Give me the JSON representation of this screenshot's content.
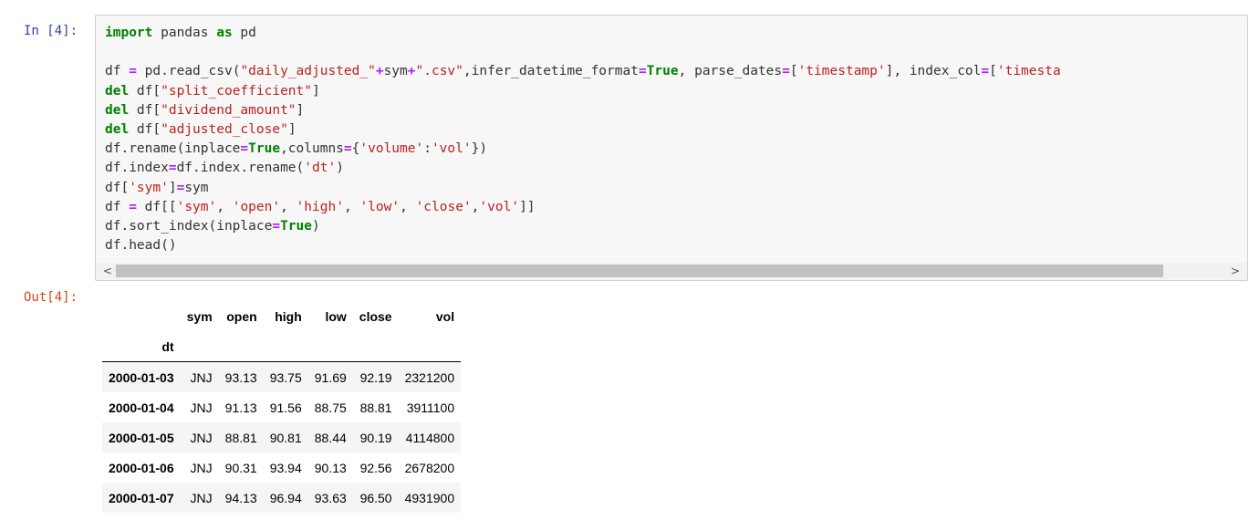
{
  "input_prompt": "In [4]:",
  "output_prompt": "Out[4]:",
  "code_lines": [
    [
      {
        "t": "import",
        "c": "kw"
      },
      {
        "t": " pandas ",
        "c": "nm"
      },
      {
        "t": "as",
        "c": "kw"
      },
      {
        "t": " pd",
        "c": "nm"
      }
    ],
    [],
    [
      {
        "t": "df ",
        "c": "nm"
      },
      {
        "t": "=",
        "c": "op"
      },
      {
        "t": " pd.read_csv(",
        "c": "nm"
      },
      {
        "t": "\"daily_adjusted_\"",
        "c": "str"
      },
      {
        "t": "+",
        "c": "op"
      },
      {
        "t": "sym",
        "c": "nm"
      },
      {
        "t": "+",
        "c": "op"
      },
      {
        "t": "\".csv\"",
        "c": "str"
      },
      {
        "t": ",infer_datetime_format",
        "c": "nm"
      },
      {
        "t": "=",
        "c": "op"
      },
      {
        "t": "True",
        "c": "kw"
      },
      {
        "t": ", parse_dates",
        "c": "nm"
      },
      {
        "t": "=",
        "c": "op"
      },
      {
        "t": "[",
        "c": "nm"
      },
      {
        "t": "'timestamp'",
        "c": "str"
      },
      {
        "t": "], index_col",
        "c": "nm"
      },
      {
        "t": "=",
        "c": "op"
      },
      {
        "t": "[",
        "c": "nm"
      },
      {
        "t": "'timesta",
        "c": "str"
      }
    ],
    [
      {
        "t": "del",
        "c": "kw"
      },
      {
        "t": " df[",
        "c": "nm"
      },
      {
        "t": "\"split_coefficient\"",
        "c": "str"
      },
      {
        "t": "]",
        "c": "nm"
      }
    ],
    [
      {
        "t": "del",
        "c": "kw"
      },
      {
        "t": " df[",
        "c": "nm"
      },
      {
        "t": "\"dividend_amount\"",
        "c": "str"
      },
      {
        "t": "]",
        "c": "nm"
      }
    ],
    [
      {
        "t": "del",
        "c": "kw"
      },
      {
        "t": " df[",
        "c": "nm"
      },
      {
        "t": "\"adjusted_close\"",
        "c": "str"
      },
      {
        "t": "]",
        "c": "nm"
      }
    ],
    [
      {
        "t": "df.rename(inplace",
        "c": "nm"
      },
      {
        "t": "=",
        "c": "op"
      },
      {
        "t": "True",
        "c": "kw"
      },
      {
        "t": ",columns",
        "c": "nm"
      },
      {
        "t": "=",
        "c": "op"
      },
      {
        "t": "{",
        "c": "nm"
      },
      {
        "t": "'volume'",
        "c": "str"
      },
      {
        "t": ":",
        "c": "nm"
      },
      {
        "t": "'vol'",
        "c": "str"
      },
      {
        "t": "})",
        "c": "nm"
      }
    ],
    [
      {
        "t": "df.index",
        "c": "nm"
      },
      {
        "t": "=",
        "c": "op"
      },
      {
        "t": "df.index.rename(",
        "c": "nm"
      },
      {
        "t": "'dt'",
        "c": "str"
      },
      {
        "t": ")",
        "c": "nm"
      }
    ],
    [
      {
        "t": "df[",
        "c": "nm"
      },
      {
        "t": "'sym'",
        "c": "str"
      },
      {
        "t": "]",
        "c": "nm"
      },
      {
        "t": "=",
        "c": "op"
      },
      {
        "t": "sym",
        "c": "nm"
      }
    ],
    [
      {
        "t": "df ",
        "c": "nm"
      },
      {
        "t": "=",
        "c": "op"
      },
      {
        "t": " df[[",
        "c": "nm"
      },
      {
        "t": "'sym'",
        "c": "str"
      },
      {
        "t": ", ",
        "c": "nm"
      },
      {
        "t": "'open'",
        "c": "str"
      },
      {
        "t": ", ",
        "c": "nm"
      },
      {
        "t": "'high'",
        "c": "str"
      },
      {
        "t": ", ",
        "c": "nm"
      },
      {
        "t": "'low'",
        "c": "str"
      },
      {
        "t": ", ",
        "c": "nm"
      },
      {
        "t": "'close'",
        "c": "str"
      },
      {
        "t": ",",
        "c": "nm"
      },
      {
        "t": "'vol'",
        "c": "str"
      },
      {
        "t": "]]",
        "c": "nm"
      }
    ],
    [
      {
        "t": "df.sort_index(inplace",
        "c": "nm"
      },
      {
        "t": "=",
        "c": "op"
      },
      {
        "t": "True",
        "c": "kw"
      },
      {
        "t": ")",
        "c": "nm"
      }
    ],
    [
      {
        "t": "df.head()",
        "c": "nm"
      }
    ]
  ],
  "scrollbar": {
    "left_arrow": "<",
    "right_arrow": ">"
  },
  "table": {
    "columns": [
      "sym",
      "open",
      "high",
      "low",
      "close",
      "vol"
    ],
    "index_name": "dt",
    "rows": [
      {
        "index": "2000-01-03",
        "values": [
          "JNJ",
          "93.13",
          "93.75",
          "91.69",
          "92.19",
          "2321200"
        ]
      },
      {
        "index": "2000-01-04",
        "values": [
          "JNJ",
          "91.13",
          "91.56",
          "88.75",
          "88.81",
          "3911100"
        ]
      },
      {
        "index": "2000-01-05",
        "values": [
          "JNJ",
          "88.81",
          "90.81",
          "88.44",
          "90.19",
          "4114800"
        ]
      },
      {
        "index": "2000-01-06",
        "values": [
          "JNJ",
          "90.31",
          "93.94",
          "90.13",
          "92.56",
          "2678200"
        ]
      },
      {
        "index": "2000-01-07",
        "values": [
          "JNJ",
          "94.13",
          "96.94",
          "93.63",
          "96.50",
          "4931900"
        ]
      }
    ]
  }
}
